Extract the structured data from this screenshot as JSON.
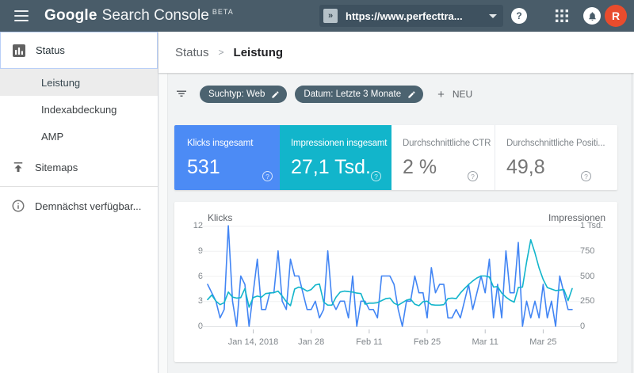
{
  "topbar": {
    "logo_google": "Google",
    "logo_product": "Search Console",
    "logo_beta": "BETA",
    "property_selector": {
      "icon_glyph": "»",
      "value": "https://www.perfecttra..."
    },
    "help_glyph": "?",
    "avatar_letter": "R"
  },
  "sidebar": {
    "status": {
      "label": "Status",
      "icon": "bar-chart"
    },
    "sub_items": [
      {
        "label": "Leistung",
        "selected": true
      },
      {
        "label": "Indexabdeckung",
        "selected": false
      },
      {
        "label": "AMP",
        "selected": false
      }
    ],
    "sitemaps": {
      "label": "Sitemaps",
      "icon": "upload"
    },
    "coming_soon": {
      "label": "Demnächst verfügbar...",
      "icon": "info"
    }
  },
  "breadcrumb": {
    "parent": "Status",
    "separator": ">",
    "current": "Leistung"
  },
  "filterbar": {
    "chips": [
      {
        "label": "Suchtyp: Web"
      },
      {
        "label": "Datum: Letzte 3 Monate"
      }
    ],
    "add_new_plus": "+",
    "add_new": "NEU"
  },
  "metric_cards": [
    {
      "title": "Klicks insgesamt",
      "value": "531",
      "bg": "#4c8bf5",
      "fg": "#ffffff",
      "qcolor": "#d7e5fd"
    },
    {
      "title": "Impressionen insgesamt",
      "value": "27,1 Tsd.",
      "bg": "#12b5cb",
      "fg": "#ffffff",
      "qcolor": "#c3eef3"
    },
    {
      "title": "Durchschnittliche CTR",
      "value": "2 %",
      "bg": "#ffffff",
      "fg": "#757575",
      "qcolor": "#9aa0a6"
    },
    {
      "title": "Durchschnittliche Positi...",
      "value": "49,8",
      "bg": "#ffffff",
      "fg": "#757575",
      "qcolor": "#9aa0a6"
    }
  ],
  "chart_data": {
    "type": "line",
    "x_tick_labels": [
      "Jan 14, 2018",
      "Jan 28",
      "Feb 11",
      "Feb 25",
      "Mar 11",
      "Mar 25"
    ],
    "x_tick_indices": [
      11,
      25,
      39,
      53,
      67,
      81
    ],
    "left_axis": {
      "label": "Klicks",
      "ticks": [
        0,
        3,
        6,
        9,
        12
      ],
      "range": [
        0,
        12
      ]
    },
    "right_axis": {
      "label": "Impressionen",
      "ticks": [
        "0",
        "250",
        "500",
        "750",
        "1 Tsd."
      ],
      "range": [
        0,
        1000
      ]
    },
    "grid": false,
    "legend": "none",
    "series": [
      {
        "name": "Klicks",
        "color": "#4285f4",
        "axis": "left",
        "values": [
          5,
          4,
          3,
          1,
          2,
          12,
          3,
          0,
          6,
          5,
          0,
          4,
          8,
          2,
          2,
          4,
          4,
          9,
          3,
          2,
          8,
          6,
          6,
          4,
          2,
          2,
          3,
          1,
          2,
          9,
          3,
          2,
          3,
          3,
          1,
          6,
          0,
          3,
          3,
          2,
          2,
          1,
          6,
          6,
          6,
          5,
          2,
          0,
          3,
          3,
          6,
          4,
          4,
          1,
          7,
          4,
          5,
          5,
          1,
          1,
          2,
          1,
          3,
          5,
          2,
          4,
          6,
          4,
          8,
          1,
          5,
          1,
          9,
          4,
          4,
          10,
          0,
          3,
          1,
          3,
          1,
          5,
          1,
          3,
          0,
          6,
          4,
          2,
          2
        ]
      },
      {
        "name": "Impressionen",
        "color": "#12b5cb",
        "axis": "right",
        "values": [
          265,
          310,
          250,
          215,
          235,
          340,
          290,
          280,
          285,
          375,
          190,
          285,
          300,
          290,
          325,
          330,
          335,
          350,
          300,
          245,
          205,
          370,
          390,
          375,
          350,
          365,
          410,
          420,
          240,
          210,
          210,
          290,
          340,
          350,
          345,
          340,
          330,
          325,
          220,
          230,
          230,
          235,
          255,
          275,
          280,
          230,
          210,
          235,
          260,
          270,
          220,
          205,
          245,
          250,
          215,
          210,
          210,
          215,
          275,
          280,
          275,
          330,
          375,
          415,
          450,
          480,
          500,
          500,
          490,
          390,
          395,
          330,
          290,
          260,
          240,
          385,
          390,
          640,
          860,
          730,
          580,
          465,
          385,
          370,
          355,
          360,
          365,
          255,
          375
        ]
      }
    ]
  }
}
